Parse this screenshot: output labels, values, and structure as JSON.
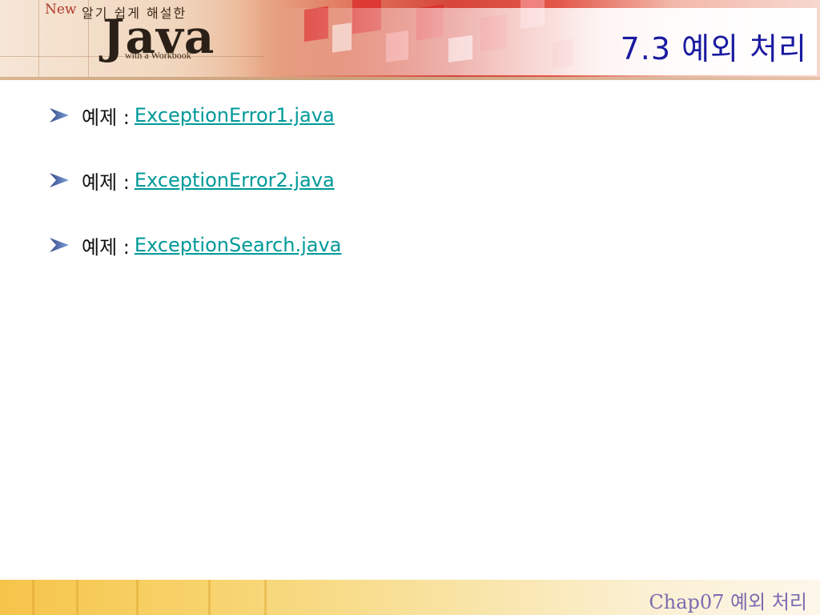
{
  "header": {
    "logo_new": "New",
    "logo_subtitle": "알기 쉽게 해설한",
    "logo_main": "Java",
    "logo_tagline": "with a Workbook",
    "slide_title": "7.3 예외 처리"
  },
  "items": [
    {
      "label": "예제 :",
      "link": "ExceptionError1.java"
    },
    {
      "label": "예제 :",
      "link": "ExceptionError2.java"
    },
    {
      "label": "예제 :",
      "link": "ExceptionSearch.java"
    }
  ],
  "footer": {
    "text": "Chap07 예외 처리"
  },
  "colors": {
    "title": "#1a1aa0",
    "link": "#009999",
    "footer_text": "#7b6bb0"
  },
  "icons": {
    "bullet": "arrow-bullet-icon"
  }
}
